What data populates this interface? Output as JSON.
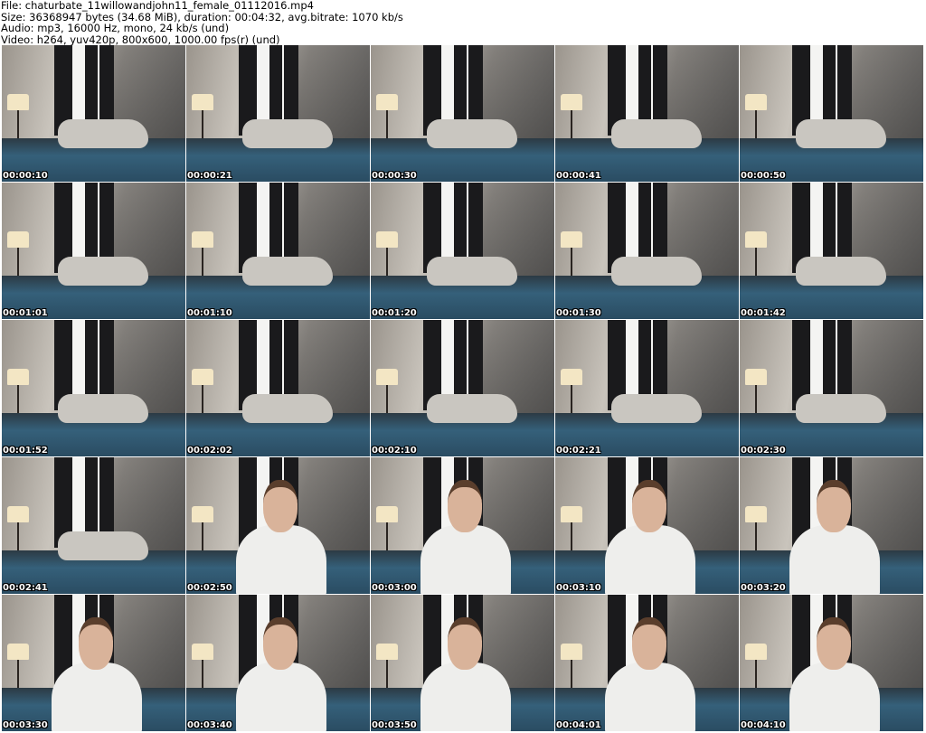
{
  "header": {
    "file": "File: chaturbate_11willowandjohn11_female_01112016.mp4",
    "size": "Size: 36368947 bytes (34.68 MiB), duration: 00:04:32, avg.bitrate: 1070 kb/s",
    "audio": "Audio: mp3, 16000 Hz, mono, 24 kb/s (und)",
    "video": "Video: h264, yuv420p, 800x600, 1000.00 fps(r) (und)"
  },
  "thumbnails": [
    {
      "timestamp": "00:00:10",
      "person": false
    },
    {
      "timestamp": "00:00:21",
      "person": false
    },
    {
      "timestamp": "00:00:30",
      "person": false
    },
    {
      "timestamp": "00:00:41",
      "person": false
    },
    {
      "timestamp": "00:00:50",
      "person": false
    },
    {
      "timestamp": "00:01:01",
      "person": false
    },
    {
      "timestamp": "00:01:10",
      "person": false
    },
    {
      "timestamp": "00:01:20",
      "person": false
    },
    {
      "timestamp": "00:01:30",
      "person": false
    },
    {
      "timestamp": "00:01:42",
      "person": false
    },
    {
      "timestamp": "00:01:52",
      "person": false
    },
    {
      "timestamp": "00:02:02",
      "person": false
    },
    {
      "timestamp": "00:02:10",
      "person": false
    },
    {
      "timestamp": "00:02:21",
      "person": false
    },
    {
      "timestamp": "00:02:30",
      "person": false
    },
    {
      "timestamp": "00:02:41",
      "person": false
    },
    {
      "timestamp": "00:02:50",
      "person": true
    },
    {
      "timestamp": "00:03:00",
      "person": true
    },
    {
      "timestamp": "00:03:10",
      "person": true
    },
    {
      "timestamp": "00:03:20",
      "person": true
    },
    {
      "timestamp": "00:03:30",
      "person": true
    },
    {
      "timestamp": "00:03:40",
      "person": true
    },
    {
      "timestamp": "00:03:50",
      "person": true
    },
    {
      "timestamp": "00:04:01",
      "person": true
    },
    {
      "timestamp": "00:04:10",
      "person": true
    }
  ]
}
